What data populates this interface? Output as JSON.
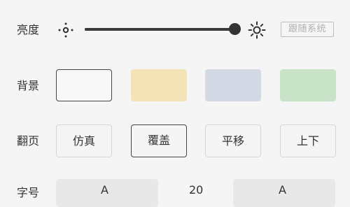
{
  "brightness": {
    "label": "亮度",
    "level_percent": 100,
    "follow_system_label": "跟随系统",
    "low_icon": "sun-low-icon",
    "high_icon": "sun-high-icon"
  },
  "background": {
    "label": "背景",
    "swatches": [
      {
        "name": "white",
        "color": "#f8f8f8",
        "selected": true
      },
      {
        "name": "yellow",
        "color": "#f3e3b7",
        "selected": false
      },
      {
        "name": "blue",
        "color": "#d3dae6",
        "selected": false
      },
      {
        "name": "green",
        "color": "#c9e3c8",
        "selected": false
      }
    ]
  },
  "page_turn": {
    "label": "翻页",
    "options": [
      "仿真",
      "覆盖",
      "平移",
      "上下"
    ],
    "selected": "覆盖"
  },
  "bottom_row": {
    "label": "字号",
    "left_glyph": "A",
    "middle_value": "20",
    "right_glyph": "A"
  },
  "colors": {
    "accent": "#333333",
    "muted": "#b0b0b0"
  }
}
